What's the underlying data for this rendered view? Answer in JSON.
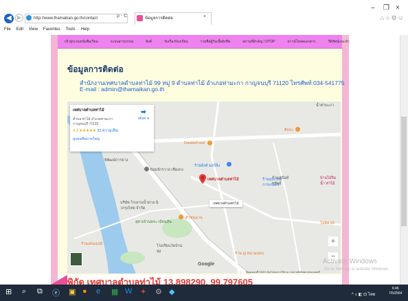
{
  "browser": {
    "url": "http://www.thamaikan.go.th/contact",
    "address_tools": "ρ - C",
    "tab_title": "ข้อมูลการติดต่อ",
    "tab_close": "×",
    "window_minimize": "–",
    "window_restore": "❐",
    "window_close": "×",
    "toolbar_icons": "⌂☆⚙☺",
    "menu": [
      "File",
      "Edit",
      "View",
      "Favorites",
      "Tools",
      "Help"
    ]
  },
  "nav": {
    "items": [
      "เข้าสู่ระบบหนังสือเวียน",
      "ระบบสารบรรณ",
      "ลิงค์",
      "รับเรื่องร้องเรียน",
      "รายชื่อผู้รับเบี้ยยังชีพ",
      "สถานที่สำคัญ / OTOP",
      "ดาวน์โหลดเอกสาร",
      "วีดิทัศน์แนะนำ"
    ]
  },
  "contact": {
    "title": "ข้อมูลการติดต่อ",
    "address": "สำนักงานเทศบาลตำบลท่าไม้ 99 หมู่ 9 ตำบลท่าไม้ อำเภอท่ามะกา กาญจนบุรี 71120 โทรศัพท์ 034-541775",
    "email": "E-mail : admin@thamaikan.go.th"
  },
  "map": {
    "card": {
      "name": "เทศบาลตำบลท่าไม้",
      "address": "ตำบล ท่าไม้ อำเภอท่ามะกา กาญจนบุรี 71120",
      "rating": "4.3 ★★★★★",
      "reviews": "22 ความเห็น",
      "larger_map": "ดูแผนที่ขนาดใหญ่",
      "directions": "เส้นทาง"
    },
    "pin_label": "เทศบาลตำบลท่าไม้",
    "info_label": "เทศบาลตำบลท่าไม้",
    "zoom_in": "+",
    "zoom_out": "−",
    "google": "Google",
    "terms": "ข้อมูลแผนที่ ©2021   ข้อกำหนดการใช้งาน   รายงานข้อผิดพลาดของแผนที่",
    "pois": [
      {
        "label": "DoubleFood"
      },
      {
        "label": "ร้านลิงค์ มอร์ลิ่ง"
      },
      {
        "label": "พิพัฒน์การยาง"
      },
      {
        "label": "ช่อมจักรวาล เซียงกง"
      },
      {
        "label": "ร้านอุปกรณ์การเกษตร"
      },
      {
        "label": "บริษัท โรงงานน้ำตาล นิวกรุงไทย จำกัด"
      },
      {
        "label": "สุดาเบ้านพระ เบียนสัน"
      },
      {
        "label": "ตัวขนุนวน"
      },
      {
        "label": "โรงเรียนวัดบ้านทุ่ง"
      },
      {
        "label": "ร้าน ญ หนามอ่อน"
      },
      {
        "label": "โลตัส 99"
      },
      {
        "label": "บ้านไม้ริมน้ำ ท่าไม้"
      },
      {
        "label": "ศิลปะ"
      },
      {
        "label": "น้ำท่ามะกา"
      },
      {
        "label": "ร้านสุนันท์ทรัพย์"
      },
      {
        "label": "ร้านเด่นเมลย์"
      }
    ]
  },
  "watermark": {
    "line1": "Activate Windows",
    "line2": "Go to Settings to activate Windows."
  },
  "coords": "พิกัด เทศบาลตำบลท่าไม้ 13.898290, 99.797605",
  "taskbar": {
    "tray": "^ ⌂ ◧ ⊡ ไทย",
    "time": "6:46",
    "date": "7/5/2564"
  },
  "colors": {
    "nav_bg": "#ee82ee",
    "page_bg": "#fffde0",
    "title": "#1b3b6b",
    "link": "#1a5fd0",
    "coords": "#e53935"
  }
}
